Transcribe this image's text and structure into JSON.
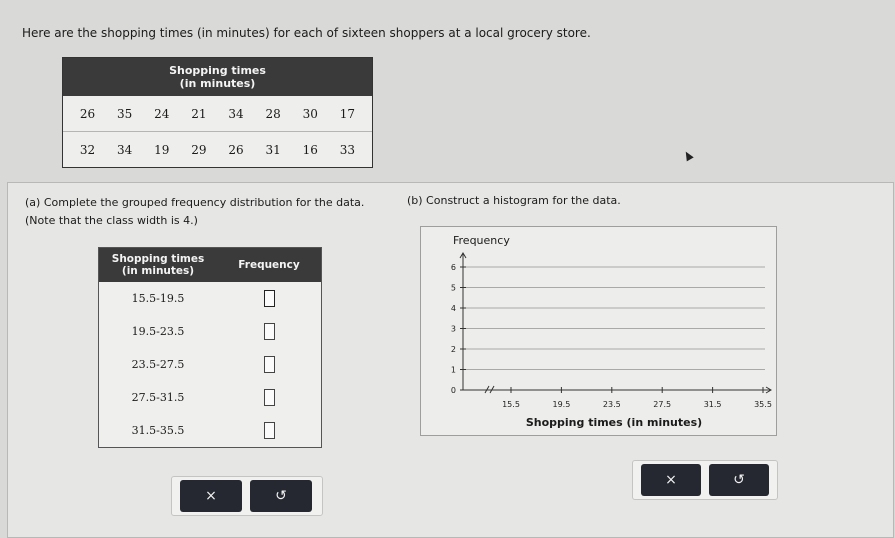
{
  "intro": "Here are the shopping times (in minutes) for each of sixteen shoppers at a local grocery store.",
  "data_table": {
    "header_line1": "Shopping times",
    "header_line2": "(in minutes)",
    "row1": [
      "26",
      "35",
      "24",
      "21",
      "34",
      "28",
      "30",
      "17"
    ],
    "row2": [
      "32",
      "34",
      "19",
      "29",
      "26",
      "31",
      "16",
      "33"
    ]
  },
  "part_a": {
    "text": "(a) Complete the grouped frequency distribution for the data. (Note that the class width is 4.)",
    "col1_line1": "Shopping times",
    "col1_line2": "(in minutes)",
    "col2": "Frequency",
    "classes": [
      "15.5-19.5",
      "19.5-23.5",
      "23.5-27.5",
      "27.5-31.5",
      "31.5-35.5"
    ]
  },
  "part_b": {
    "text": "(b) Construct a histogram for the data."
  },
  "chart_data": {
    "type": "bar",
    "ylabel": "Frequency",
    "xlabel": "Shopping times (in minutes)",
    "x_ticks": [
      "15.5",
      "19.5",
      "23.5",
      "27.5",
      "31.5",
      "35.5"
    ],
    "y_ticks": [
      "0",
      "1",
      "2",
      "3",
      "4",
      "5",
      "6"
    ],
    "ylim": [
      0,
      6
    ],
    "categories": [
      "15.5-19.5",
      "19.5-23.5",
      "23.5-27.5",
      "27.5-31.5",
      "31.5-35.5"
    ],
    "values": [],
    "grid": true
  },
  "buttons": {
    "clear_symbol": "×",
    "undo_symbol": "↺"
  }
}
